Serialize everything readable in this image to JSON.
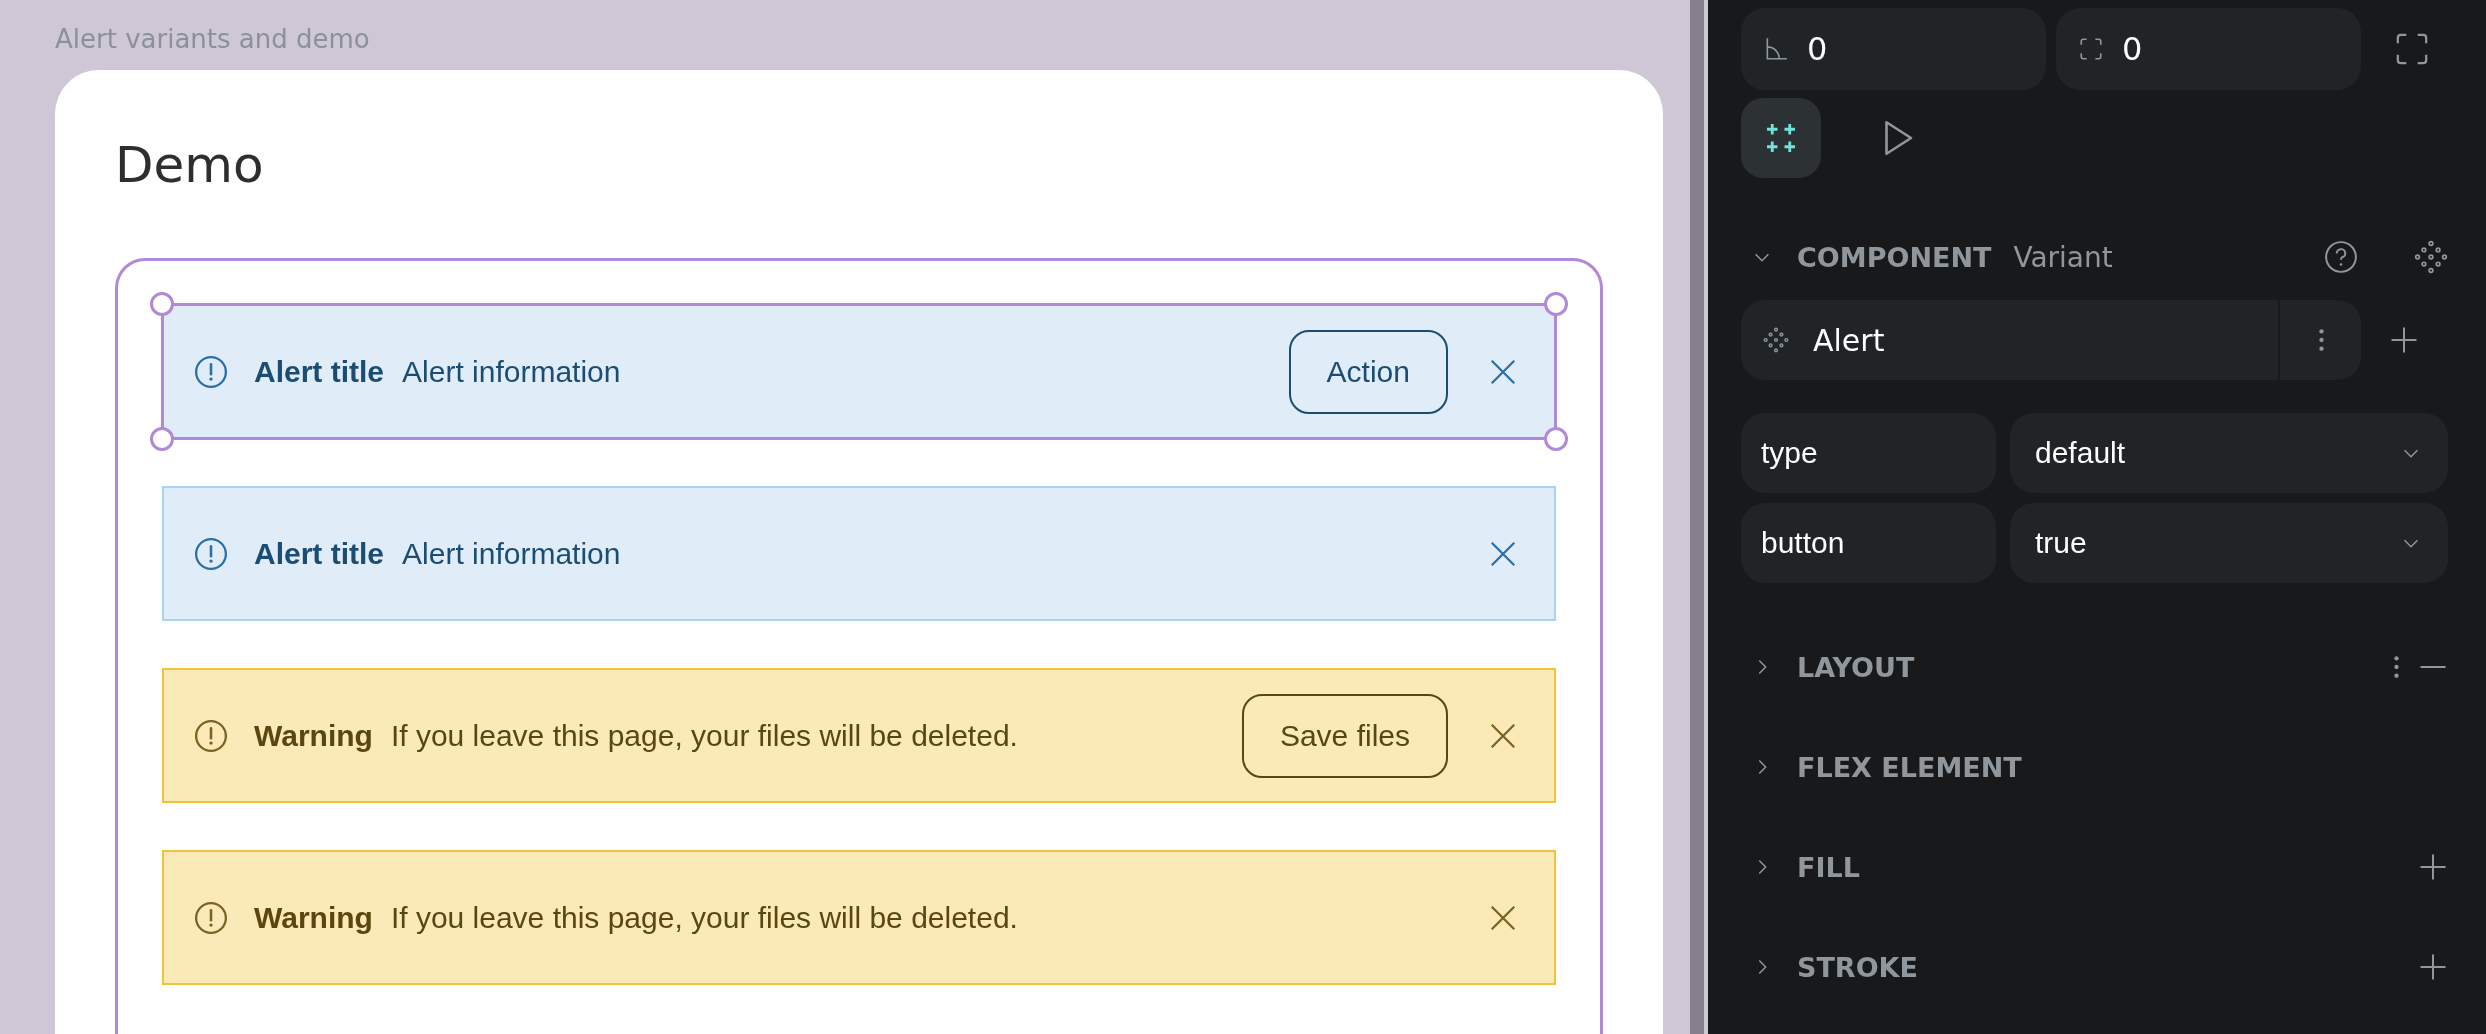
{
  "canvas": {
    "frame_label": "Alert variants and demo",
    "card_title": "Demo",
    "alerts": [
      {
        "kind": "info",
        "selected": true,
        "title": "Alert title",
        "message": "Alert information",
        "action": "Action"
      },
      {
        "kind": "info",
        "selected": false,
        "title": "Alert title",
        "message": "Alert information"
      },
      {
        "kind": "warning",
        "selected": false,
        "title": "Warning",
        "message": "If you leave this page, your files will be deleted.",
        "action": "Save files"
      },
      {
        "kind": "warning",
        "selected": false,
        "title": "Warning",
        "message": "If you leave this page, your files will be deleted."
      }
    ]
  },
  "inspector": {
    "radius": "0",
    "clip": "0",
    "tools": [
      {
        "kind": "grid",
        "selected": true
      },
      {
        "kind": "play",
        "selected": false
      }
    ],
    "component": {
      "heading": "COMPONENT",
      "subheading": "Variant",
      "expanded": true,
      "name": "Alert"
    },
    "properties": [
      {
        "name": "type",
        "value": "default"
      },
      {
        "name": "button",
        "value": "true"
      }
    ],
    "sections": [
      {
        "title": "LAYOUT",
        "expanded": false,
        "kind": "remove"
      },
      {
        "title": "FLEX ELEMENT",
        "expanded": false,
        "kind": "plain"
      },
      {
        "title": "FILL",
        "expanded": false,
        "kind": "add"
      },
      {
        "title": "STROKE",
        "expanded": false,
        "kind": "add"
      }
    ]
  }
}
